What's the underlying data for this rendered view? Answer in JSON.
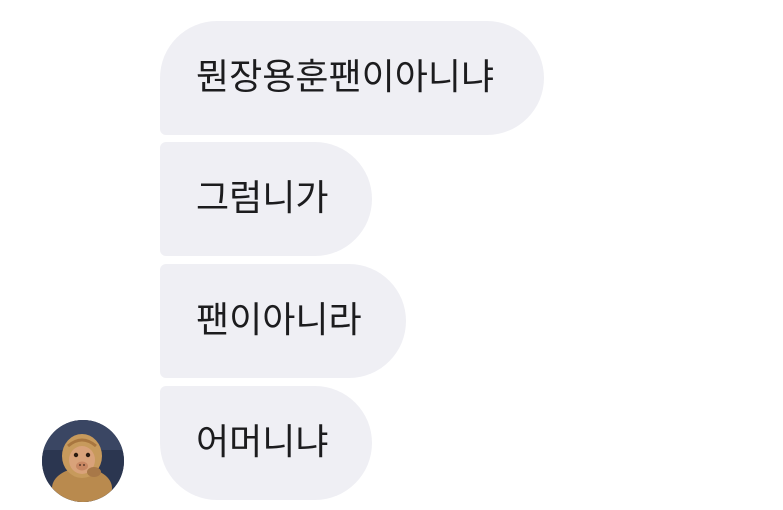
{
  "conversation": {
    "messages": [
      {
        "text": "뭔장용훈팬이아니냐"
      },
      {
        "text": "그럼니가"
      },
      {
        "text": "팬이아니라"
      },
      {
        "text": "어머니냐"
      }
    ],
    "sender": {
      "avatar_icon": "monkey-avatar-icon"
    }
  },
  "colors": {
    "background": "#ffffff",
    "bubble": "#efeff4",
    "text": "#1c1c1e"
  }
}
